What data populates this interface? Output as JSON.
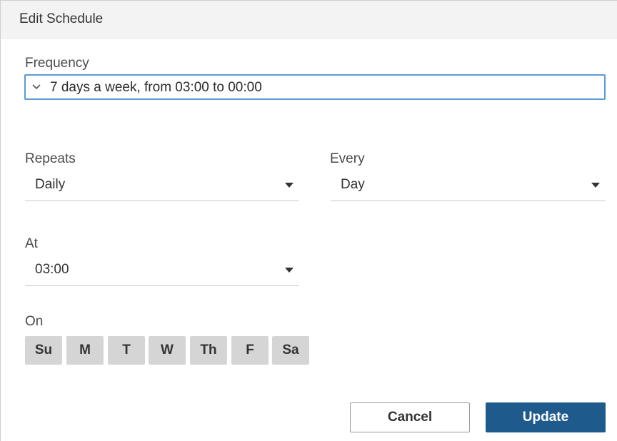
{
  "dialog": {
    "title": "Edit Schedule"
  },
  "frequency": {
    "label": "Frequency",
    "value": "7 days a week, from 03:00 to 00:00",
    "icon": "chevron-down-icon"
  },
  "repeats": {
    "label": "Repeats",
    "value": "Daily",
    "icon": "caret-down-icon"
  },
  "every": {
    "label": "Every",
    "value": "Day",
    "icon": "caret-down-icon"
  },
  "at": {
    "label": "At",
    "value": "03:00",
    "icon": "caret-down-icon"
  },
  "on": {
    "label": "On",
    "days": [
      "Su",
      "M",
      "T",
      "W",
      "Th",
      "F",
      "Sa"
    ]
  },
  "buttons": {
    "cancel": "Cancel",
    "update": "Update"
  },
  "colors": {
    "header_bg": "#f3f3f3",
    "focus_border": "#5b9bd5",
    "day_bg": "#d5d5d5",
    "primary": "#1f5a8c"
  }
}
